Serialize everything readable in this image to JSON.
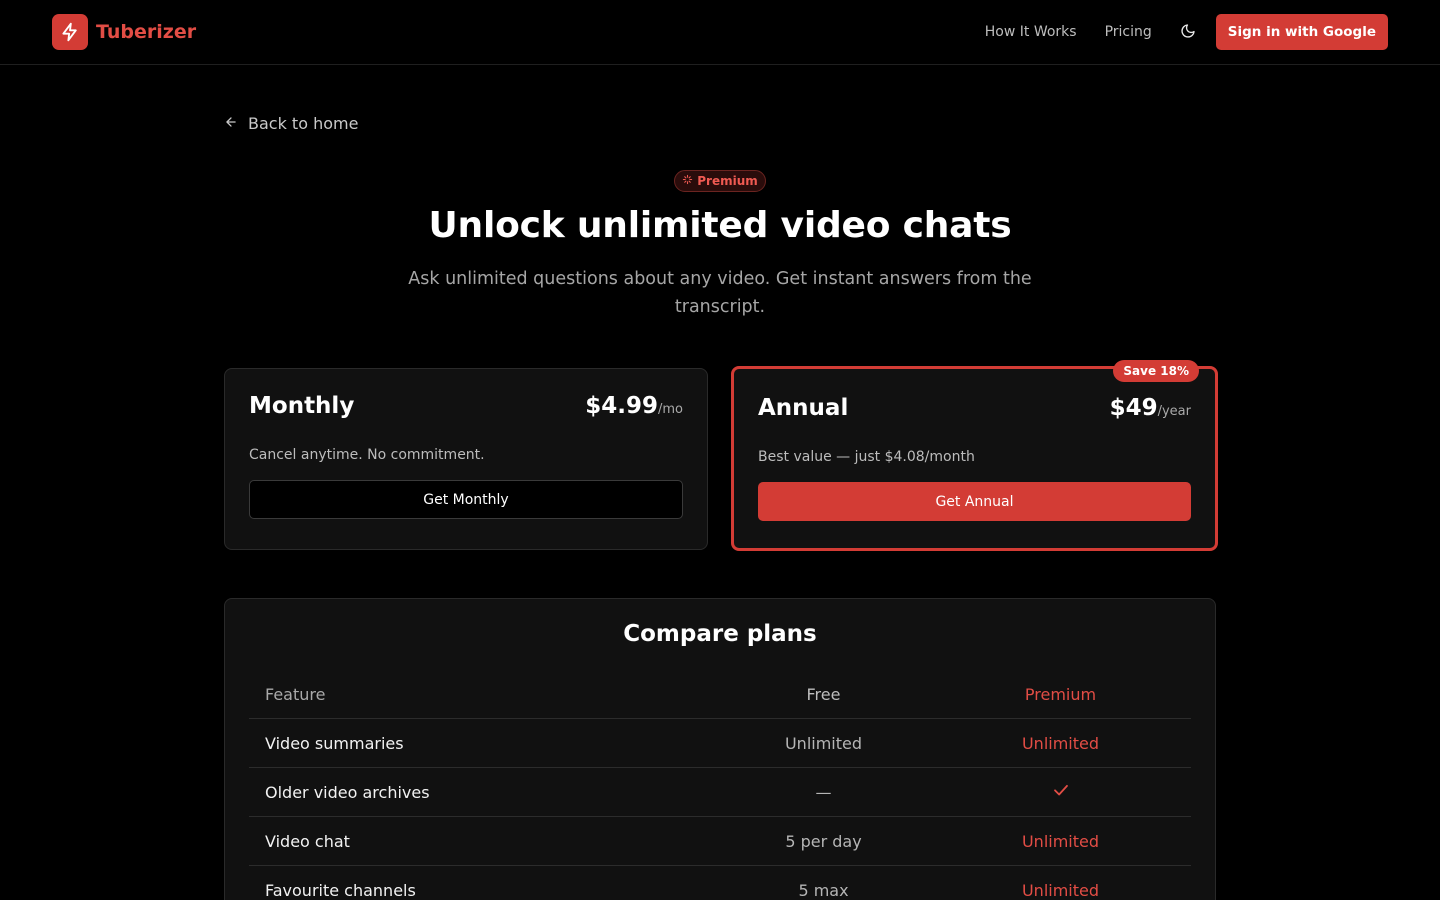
{
  "header": {
    "brand": "Tuberizer",
    "nav": [
      "How It Works",
      "Pricing"
    ],
    "signin_label": "Sign in with Google",
    "icons": {
      "logo": "lightning-bolt-icon",
      "theme": "moon-icon"
    }
  },
  "back_label": "Back to home",
  "hero": {
    "badge": "Premium",
    "title": "Unlock unlimited video chats",
    "subtitle": "Ask unlimited questions about any video. Get instant answers from the transcript."
  },
  "plans": {
    "monthly": {
      "name": "Monthly",
      "price": "$4.99",
      "period": "/mo",
      "description": "Cancel anytime. No commitment.",
      "button": "Get Monthly"
    },
    "annual": {
      "name": "Annual",
      "price": "$49",
      "period": "/year",
      "description": "Best value — just $4.08/month",
      "button": "Get Annual",
      "save_badge": "Save 18%"
    }
  },
  "compare": {
    "title": "Compare plans",
    "headers": {
      "feature": "Feature",
      "free": "Free",
      "premium": "Premium"
    },
    "rows": [
      {
        "feature": "Video summaries",
        "free": "Unlimited",
        "premium": "Unlimited"
      },
      {
        "feature": "Older video archives",
        "free": "—",
        "premium": "check"
      },
      {
        "feature": "Video chat",
        "free": "5 per day",
        "premium": "Unlimited"
      },
      {
        "feature": "Favourite channels",
        "free": "5 max",
        "premium": "Unlimited"
      }
    ]
  },
  "colors": {
    "accent": "#d33c35",
    "accent_text": "#e24d45",
    "background": "#000000",
    "card": "#111111"
  }
}
